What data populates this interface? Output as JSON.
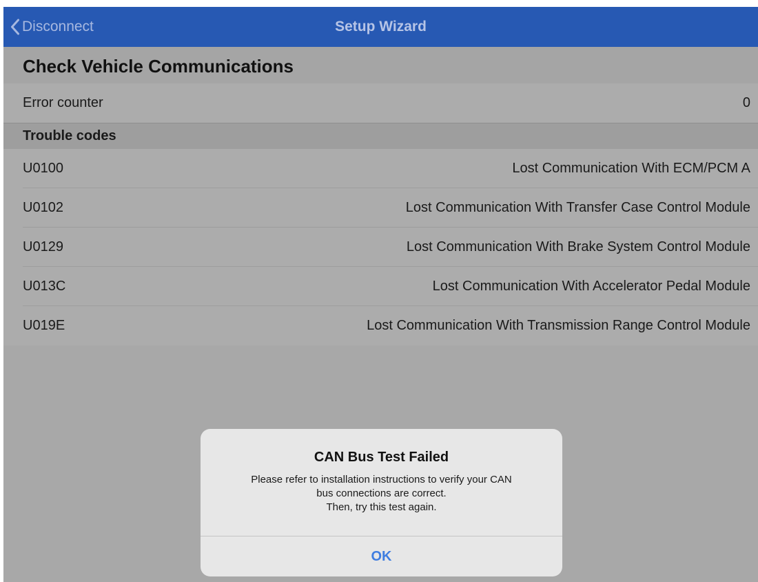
{
  "navbar": {
    "back_label": "Disconnect",
    "title": "Setup Wizard",
    "back_icon": "chevron-left-icon"
  },
  "page": {
    "title": "Check Vehicle Communications"
  },
  "error_counter": {
    "label": "Error counter",
    "value": "0"
  },
  "trouble_codes": {
    "header": "Trouble codes",
    "items": [
      {
        "code": "U0100",
        "description": "Lost Communication With ECM/PCM A"
      },
      {
        "code": "U0102",
        "description": "Lost Communication With Transfer Case Control Module"
      },
      {
        "code": "U0129",
        "description": "Lost Communication With Brake System Control Module"
      },
      {
        "code": "U013C",
        "description": "Lost Communication With Accelerator Pedal Module"
      },
      {
        "code": "U019E",
        "description": "Lost Communication With Transmission Range Control Module"
      }
    ]
  },
  "alert": {
    "title": "CAN Bus Test Failed",
    "message_lines": [
      "Please refer to installation instructions to verify your CAN",
      "bus connections are correct.",
      "Then, try this test again."
    ],
    "button_label": "OK"
  },
  "colors": {
    "navbar": "#2759b3",
    "dimmed_background": "#a8a8a8",
    "alert_background": "#e7e7e7",
    "accent": "#3f7de0"
  }
}
